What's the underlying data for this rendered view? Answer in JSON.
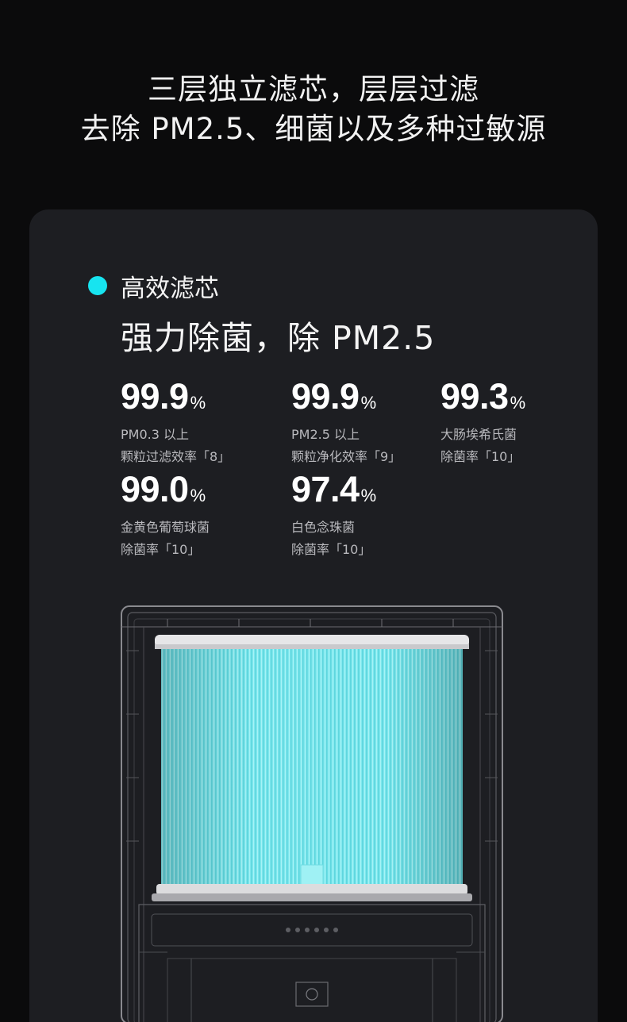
{
  "headline": {
    "line1": "三层独立滤芯，层层过滤",
    "line2": "去除 PM2.5、细菌以及多种过敏源"
  },
  "card": {
    "label": "高效滤芯",
    "subtitle": "强力除菌，除 PM2.5",
    "accent_color": "#17e4f0",
    "stats": [
      {
        "value": "99.9",
        "unit": "%",
        "desc1": "PM0.3 以上",
        "desc2": "颗粒过滤效率「8」"
      },
      {
        "value": "99.9",
        "unit": "%",
        "desc1": "PM2.5 以上",
        "desc2": "颗粒净化效率「9」"
      },
      {
        "value": "99.3",
        "unit": "%",
        "desc1": "大肠埃希氏菌",
        "desc2": "除菌率「10」"
      },
      {
        "value": "99.0",
        "unit": "%",
        "desc1": "金黄色葡萄球菌",
        "desc2": "除菌率「10」"
      },
      {
        "value": "97.4",
        "unit": "%",
        "desc1": "白色念珠菌",
        "desc2": "除菌率「10」"
      }
    ],
    "image": {
      "icon": "air-purifier-filter-illustration",
      "filter_color": "#7de6ea"
    }
  }
}
